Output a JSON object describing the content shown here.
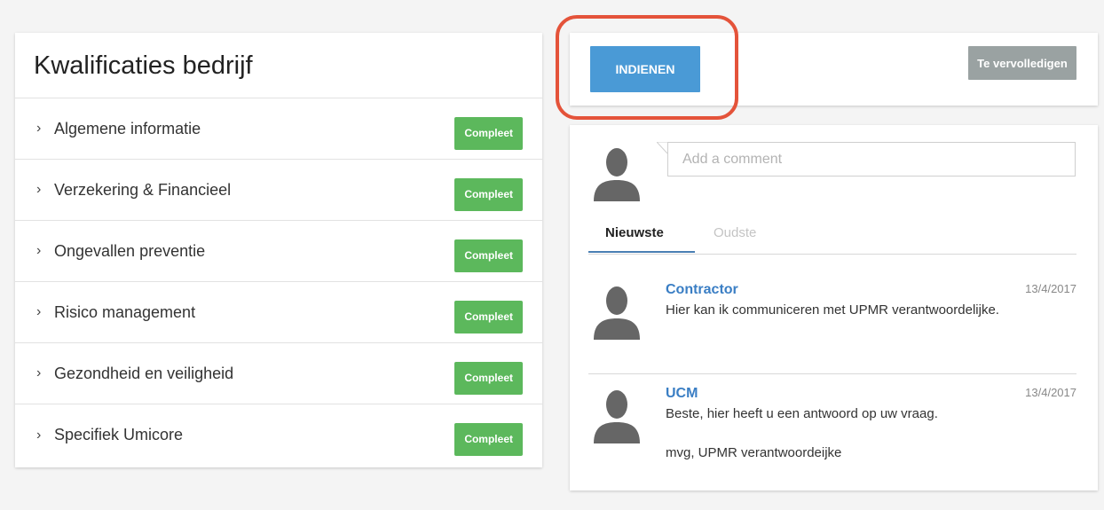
{
  "left": {
    "title": "Kwalificaties bedrijf",
    "items": [
      {
        "label": "Algemene informatie",
        "status": "Compleet"
      },
      {
        "label": "Verzekering & Financieel",
        "status": "Compleet"
      },
      {
        "label": "Ongevallen preventie",
        "status": "Compleet"
      },
      {
        "label": "Risico management",
        "status": "Compleet"
      },
      {
        "label": "Gezondheid en veiligheid",
        "status": "Compleet"
      },
      {
        "label": "Specifiek Umicore",
        "status": "Compleet"
      }
    ],
    "chevron": "›"
  },
  "actions": {
    "submit_label": "INDIENEN",
    "todo_label": "Te vervolledigen"
  },
  "comments": {
    "placeholder": "Add a comment",
    "tabs": {
      "newest": "Nieuwste",
      "oldest": "Oudste"
    },
    "items": [
      {
        "author": "Contractor",
        "date": "13/4/2017",
        "text": "Hier kan ik communiceren met UPMR verantwoordelijke."
      },
      {
        "author": "UCM",
        "date": "13/4/2017",
        "text": "Beste, hier heeft u een antwoord op uw vraag.\n\nmvg, UPMR verantwoordeijke"
      }
    ]
  },
  "colors": {
    "accent": "#4a9ad6",
    "success": "#5cb85c",
    "highlight": "#e4533a",
    "muted_button": "#9aa2a2",
    "link": "#3a7ec4"
  },
  "icons": [
    "chevron-right-icon",
    "user-avatar-icon"
  ]
}
